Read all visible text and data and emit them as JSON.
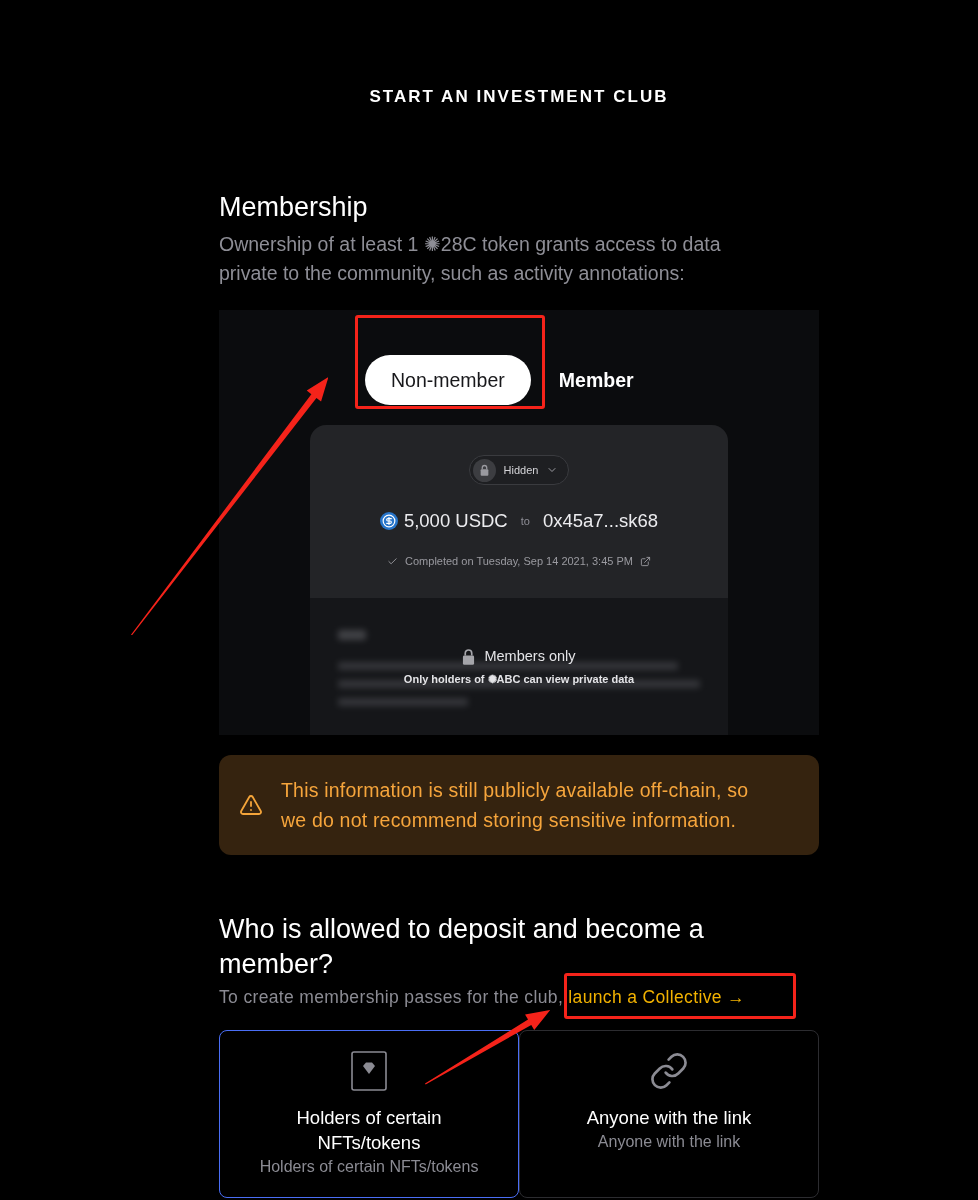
{
  "page": {
    "title": "START AN INVESTMENT CLUB"
  },
  "membership": {
    "heading": "Membership",
    "description": "Ownership of at least 1 ✺28C token grants access to data private to the community, such as activity annotations:",
    "preview": {
      "tabs": [
        {
          "label": "Non-member",
          "selected": true,
          "highlighted": true
        },
        {
          "label": "Member",
          "selected": false,
          "highlighted": false
        }
      ],
      "transaction": {
        "visibility": "Hidden",
        "amount": "5,000 USDC",
        "connector": "to",
        "recipient": "0x45a7...sk68",
        "status": "Completed on Tuesday, Sep 14 2021, 3:45 PM"
      },
      "private_note": {
        "title": "Members only",
        "message": "Only holders of ✺ABC can view private data"
      }
    },
    "warning": "This information is still publicly available off-chain, so we do not recommend storing sensitive information."
  },
  "deposit": {
    "heading": "Who is allowed to deposit and become a member?",
    "hint": "To create membership passes for the club,",
    "link": {
      "text": "launch a Collective →",
      "highlighted": true
    },
    "options": [
      {
        "kind": "nft",
        "title": "Holders of certain NFTs/tokens",
        "subtitle": "Holders of certain NFTs/tokens",
        "selected": true
      },
      {
        "kind": "link",
        "title": "Anyone with the link",
        "subtitle": "Anyone with the link",
        "selected": false
      }
    ]
  },
  "annotations": [
    {
      "kind": "arrow"
    },
    {
      "kind": "arrow"
    }
  ]
}
